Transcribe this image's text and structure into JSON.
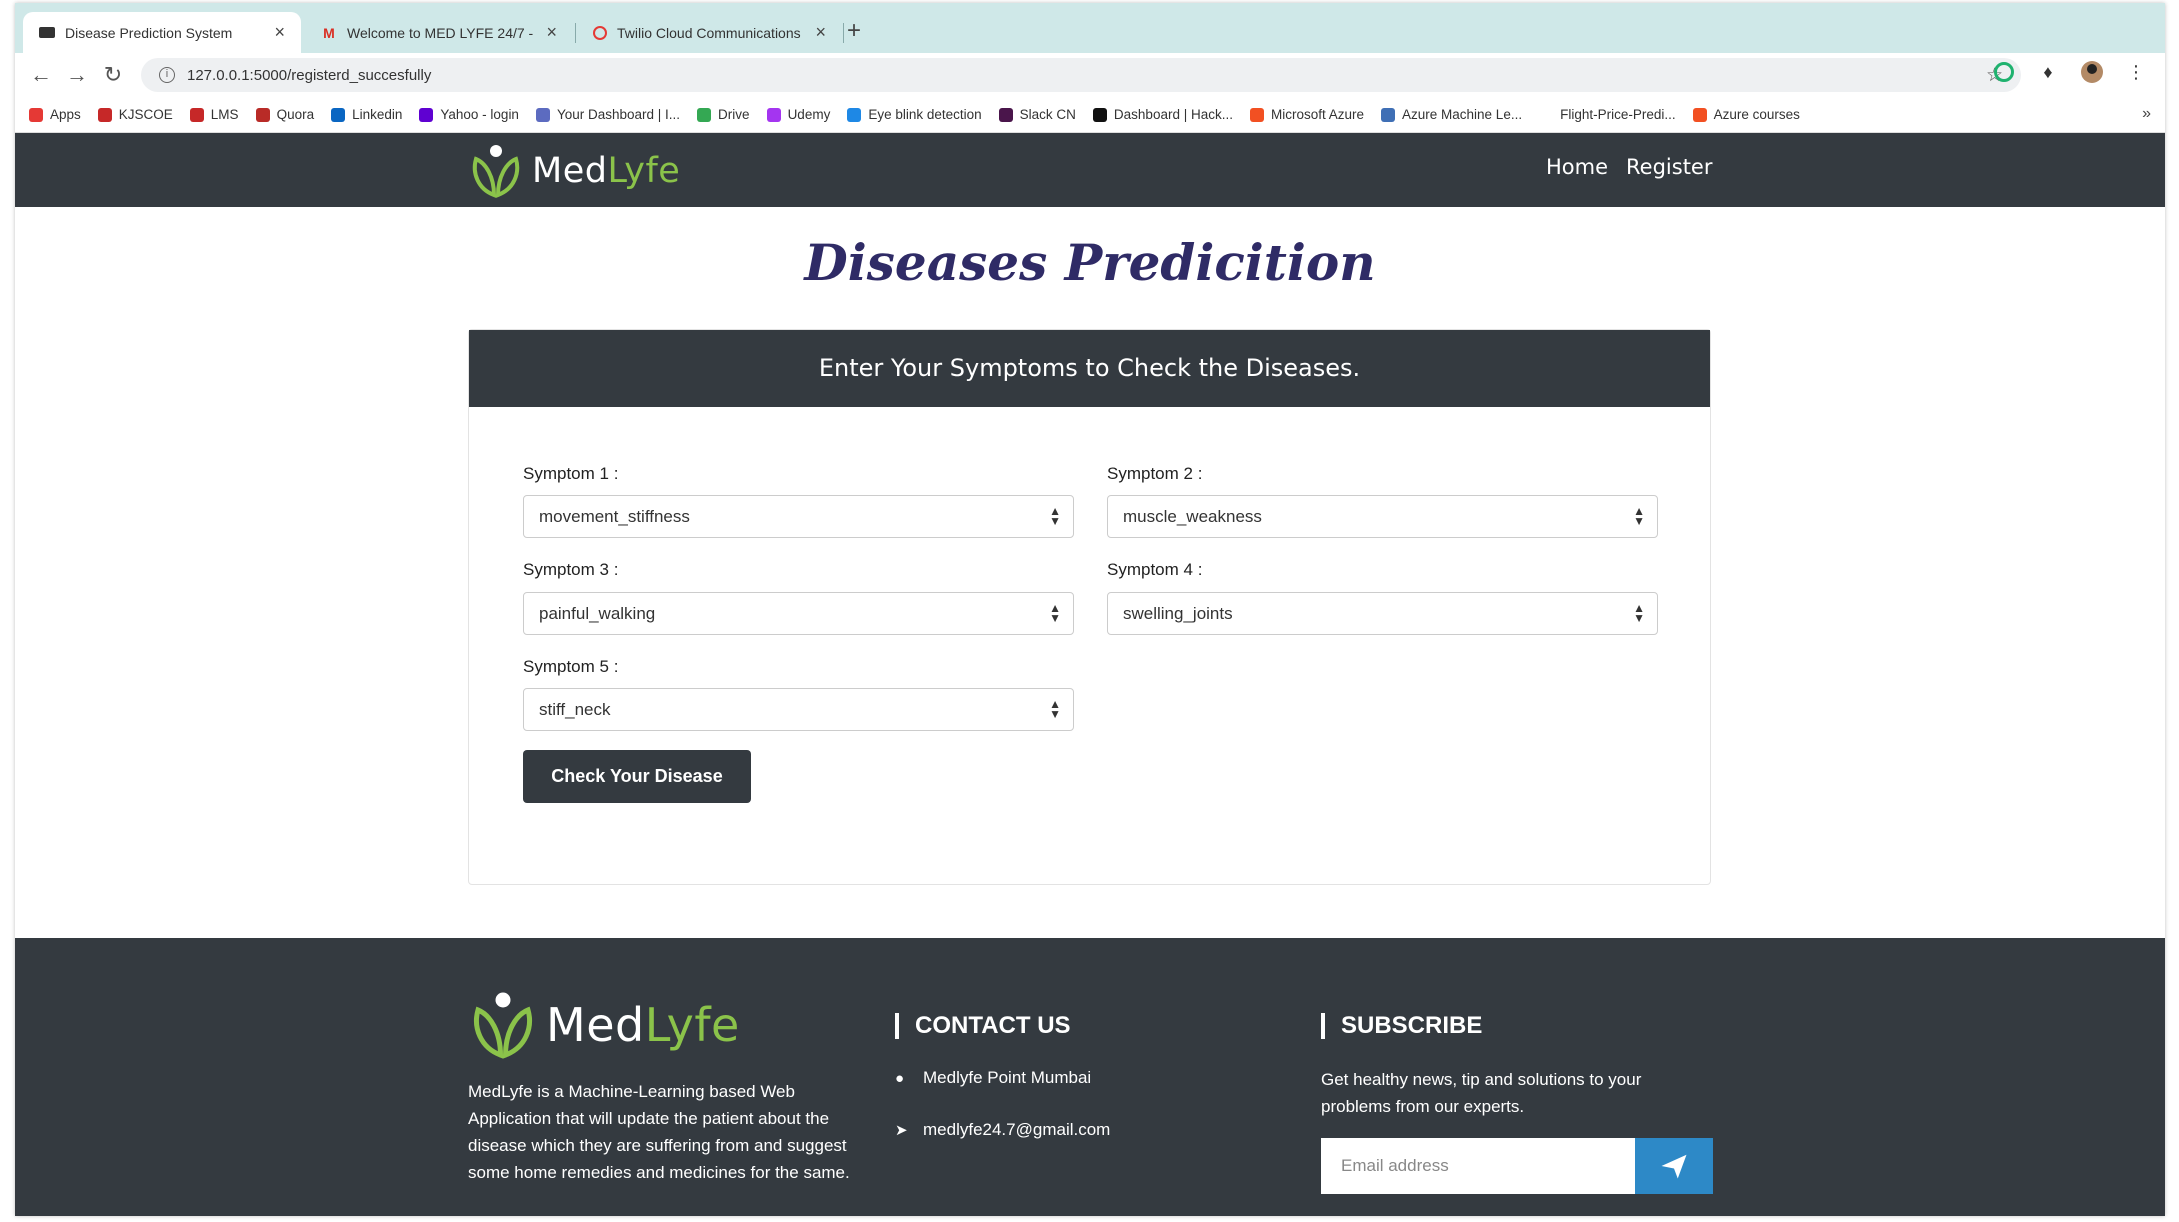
{
  "browser": {
    "tabs": [
      {
        "title": "Disease Prediction System",
        "active": true
      },
      {
        "title": "Welcome to MED LYFE 24/7 - …",
        "active": false
      },
      {
        "title": "Twilio Cloud Communications |",
        "active": false
      }
    ],
    "new_tab_symbol": "+",
    "close_symbol": "×",
    "url": "127.0.0.1:5000/registerd_succesfully"
  },
  "bookmarks": [
    {
      "label": "Apps",
      "color": "#e53935"
    },
    {
      "label": "KJSCOE",
      "color": "#c62828"
    },
    {
      "label": "LMS",
      "color": "#c62828"
    },
    {
      "label": "Quora",
      "color": "#b92b27"
    },
    {
      "label": "Linkedin",
      "color": "#0a66c2"
    },
    {
      "label": "Yahoo - login",
      "color": "#5f01d1"
    },
    {
      "label": "Your Dashboard | I...",
      "color": "#5c6bc0"
    },
    {
      "label": "Drive",
      "color": "#34a853"
    },
    {
      "label": "Udemy",
      "color": "#a435f0"
    },
    {
      "label": "Eye blink detection",
      "color": "#1e88e5"
    },
    {
      "label": "Slack CN",
      "color": "#4a154b"
    },
    {
      "label": "Dashboard | Hack...",
      "color": "#111111"
    },
    {
      "label": "Microsoft Azure",
      "color": "#f25022"
    },
    {
      "label": "Azure Machine Le...",
      "color": "#3f6fb5"
    },
    {
      "label": "Flight-Price-Predi...",
      "color": "#ffffff"
    },
    {
      "label": "Azure courses",
      "color": "#f25022"
    }
  ],
  "bookmarks_more": "»",
  "navbar": {
    "brand_med": "Med",
    "brand_lyfe": "Lyfe",
    "links": [
      "Home",
      "Register"
    ]
  },
  "page_title": "Diseases Predicition",
  "card": {
    "header": "Enter Your Symptoms to Check the Diseases.",
    "symptoms": [
      {
        "label": "Symptom 1 :",
        "value": "movement_stiffness"
      },
      {
        "label": "Symptom 2 :",
        "value": "muscle_weakness"
      },
      {
        "label": "Symptom 3 :",
        "value": "painful_walking"
      },
      {
        "label": "Symptom 4 :",
        "value": "swelling_joints"
      },
      {
        "label": "Symptom 5 :",
        "value": "stiff_neck"
      }
    ],
    "button": "Check Your Disease"
  },
  "footer": {
    "brand_med": "Med",
    "brand_lyfe": "Lyfe",
    "about": "MedLyfe is a Machine-Learning based Web Application that will update the patient about the disease which they are suffering from and suggest some home remedies and medicines for the same.",
    "contact_heading": "CONTACT US",
    "contact": {
      "address": "Medlyfe Point Mumbai",
      "email": "medlyfe24.7@gmail.com"
    },
    "subscribe_heading": "SUBSCRIBE",
    "subscribe_text": "Get healthy news, tip and solutions to your problems from our experts.",
    "email_placeholder": "Email address"
  },
  "colors": {
    "navbar_bg": "#343a40",
    "title_color": "#2f2b66",
    "brand_green": "#8bc34a",
    "subscribe_button": "#2d89c7",
    "tabstrip": "#cfe8e8"
  }
}
